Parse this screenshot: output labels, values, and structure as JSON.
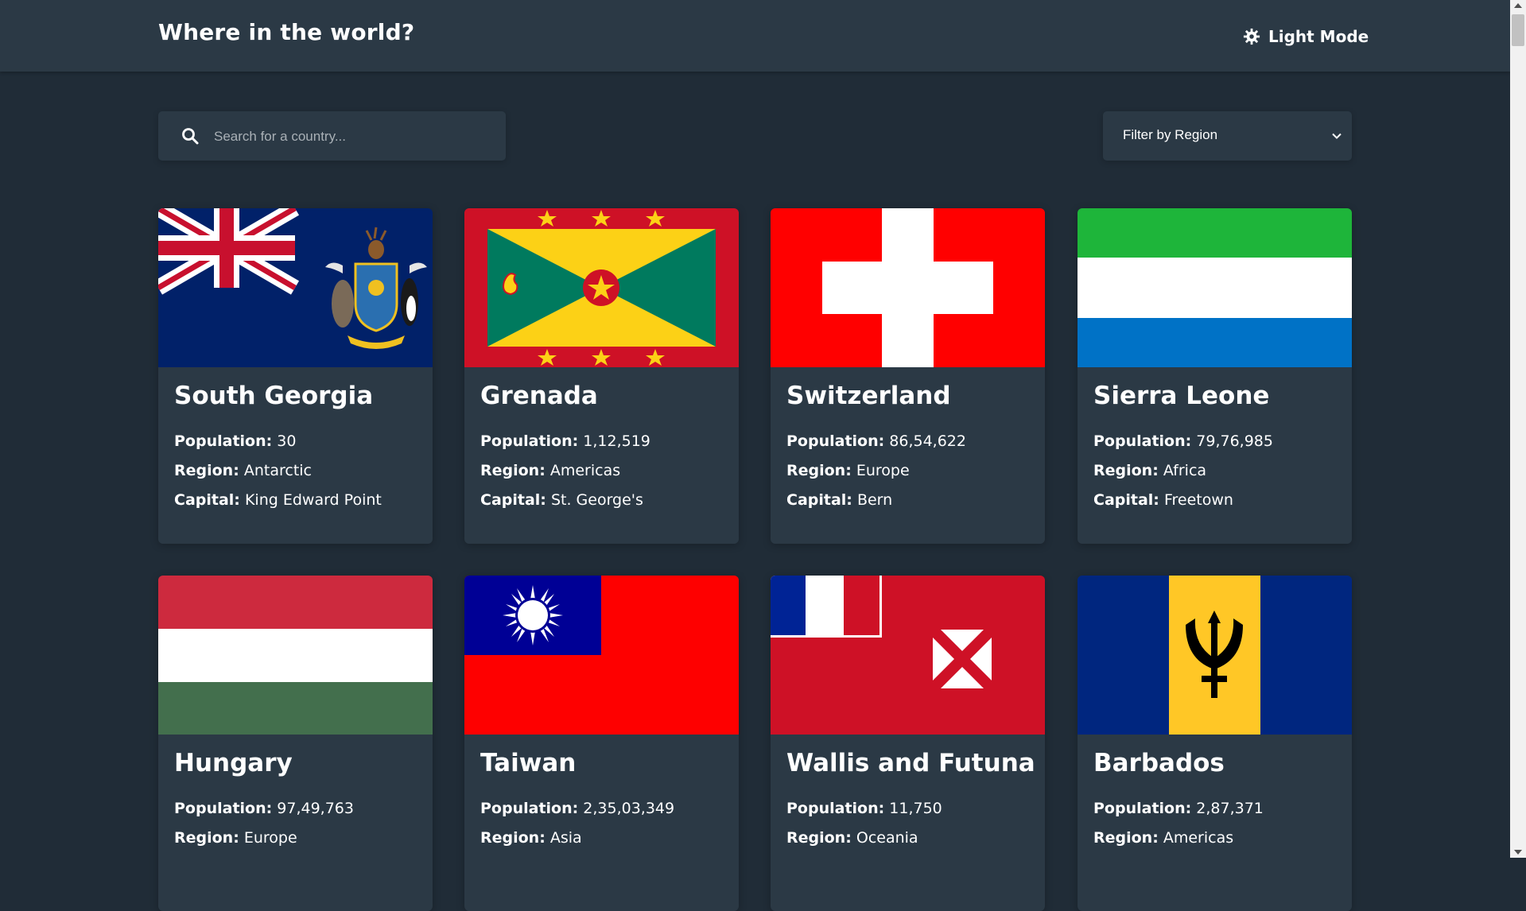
{
  "header": {
    "title": "Where in the world?",
    "theme_toggle_label": "Light Mode",
    "theme_icon": "gear-icon"
  },
  "search": {
    "placeholder": "Search for a country...",
    "value": ""
  },
  "filter": {
    "label": "Filter by Region"
  },
  "labels": {
    "population": "Population:",
    "region": "Region:",
    "capital": "Capital:"
  },
  "countries": [
    {
      "name": "South Georgia",
      "population": "30",
      "region": "Antarctic",
      "capital": "King Edward Point",
      "flag": "south-georgia-flag"
    },
    {
      "name": "Grenada",
      "population": "1,12,519",
      "region": "Americas",
      "capital": "St. George's",
      "flag": "grenada-flag"
    },
    {
      "name": "Switzerland",
      "population": "86,54,622",
      "region": "Europe",
      "capital": "Bern",
      "flag": "switzerland-flag"
    },
    {
      "name": "Sierra Leone",
      "population": "79,76,985",
      "region": "Africa",
      "capital": "Freetown",
      "flag": "sierra-leone-flag"
    },
    {
      "name": "Hungary",
      "population": "97,49,763",
      "region": "Europe",
      "capital": "",
      "flag": "hungary-flag"
    },
    {
      "name": "Taiwan",
      "population": "2,35,03,349",
      "region": "Asia",
      "capital": "",
      "flag": "taiwan-flag"
    },
    {
      "name": "Wallis and Futuna",
      "population": "11,750",
      "region": "Oceania",
      "capital": "",
      "flag": "wallis-and-futuna-flag"
    },
    {
      "name": "Barbados",
      "population": "2,87,371",
      "region": "Americas",
      "capital": "",
      "flag": "barbados-flag"
    }
  ],
  "colors": {
    "background": "#202c37",
    "element": "#2b3945",
    "text": "#ffffff"
  }
}
